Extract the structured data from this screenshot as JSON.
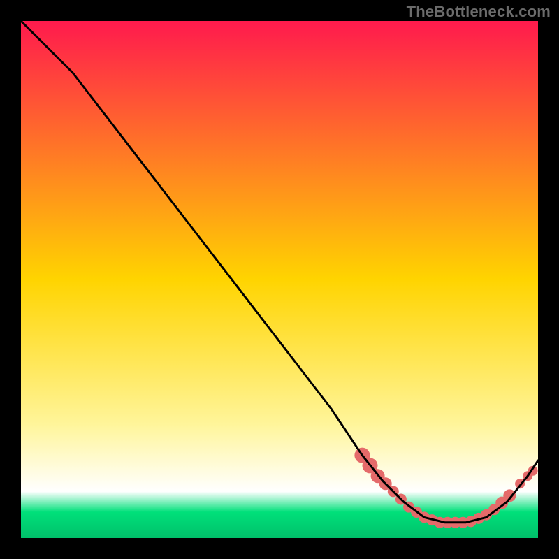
{
  "watermark": "TheBottleneck.com",
  "chart_data": {
    "type": "line",
    "title": "",
    "xlabel": "",
    "ylabel": "",
    "xlim": [
      0,
      100
    ],
    "ylim": [
      0,
      100
    ],
    "grid": false,
    "legend": false,
    "background_gradient": {
      "stops": [
        {
          "offset": 0.0,
          "color": "#ff1a4d"
        },
        {
          "offset": 0.5,
          "color": "#ffd400"
        },
        {
          "offset": 0.78,
          "color": "#fff59a"
        },
        {
          "offset": 0.91,
          "color": "#ffffff"
        },
        {
          "offset": 0.95,
          "color": "#00e07a"
        },
        {
          "offset": 1.0,
          "color": "#00c06a"
        }
      ]
    },
    "series": [
      {
        "name": "bottleneck-curve",
        "color": "#000000",
        "x": [
          0,
          6,
          10,
          20,
          30,
          40,
          50,
          60,
          66,
          70,
          74,
          78,
          82,
          86,
          90,
          94,
          98,
          100
        ],
        "y": [
          100,
          94,
          90,
          77,
          64,
          51,
          38,
          25,
          16,
          11,
          7,
          4,
          3,
          3,
          4,
          7,
          12,
          15
        ]
      }
    ],
    "markers": {
      "name": "highlight-region",
      "color": "#e46a6a",
      "radius_seq": [
        11,
        11,
        10,
        9,
        8,
        8,
        8,
        8,
        8,
        8,
        8,
        8,
        8,
        8,
        8,
        8,
        8,
        8,
        9,
        9,
        7,
        7,
        7
      ],
      "x": [
        66,
        67.5,
        69,
        70.5,
        72,
        73.5,
        75,
        76.5,
        78,
        79.5,
        81,
        82.5,
        84,
        85.5,
        87,
        88.5,
        90,
        91.5,
        93,
        94.5,
        96.5,
        98,
        99
      ],
      "y": [
        16,
        14,
        12,
        10.5,
        9,
        7.5,
        6,
        5,
        4,
        3.5,
        3,
        3,
        3,
        3,
        3.2,
        3.8,
        4.5,
        5.5,
        6.8,
        8.2,
        10.5,
        12,
        13
      ]
    }
  }
}
